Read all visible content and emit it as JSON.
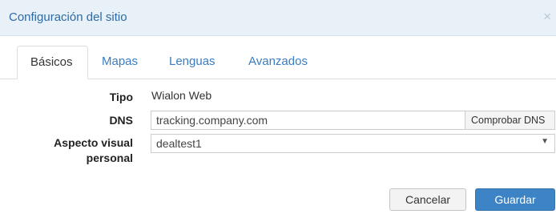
{
  "dialog": {
    "title": "Configuración del sitio",
    "close_label": "×"
  },
  "tabs": [
    {
      "label": "Básicos",
      "active": true
    },
    {
      "label": "Mapas",
      "active": false
    },
    {
      "label": "Lenguas",
      "active": false
    },
    {
      "label": "Avanzados",
      "active": false
    }
  ],
  "form": {
    "tipo_label": "Tipo",
    "tipo_value": "Wialon Web",
    "dns_label": "DNS",
    "dns_value": "tracking.company.com",
    "dns_check_label": "Comprobar DNS",
    "skin_label_line1": "Aspecto visual",
    "skin_label_line2": "personal",
    "skin_value": "dealtest1"
  },
  "footer": {
    "cancel_label": "Cancelar",
    "save_label": "Guardar"
  },
  "colors": {
    "accent": "#3d84c6",
    "title_text": "#2d6aa6",
    "title_bg": "#e8f1f8",
    "tab_link": "#3a7cc3"
  }
}
